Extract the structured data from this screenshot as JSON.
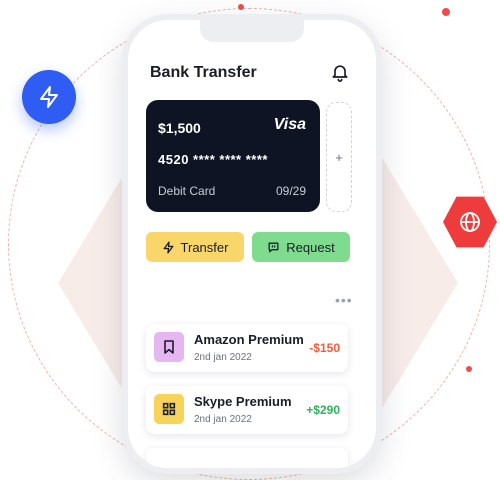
{
  "header": {
    "title": "Bank Transfer",
    "bell_icon": "bell-icon"
  },
  "card": {
    "balance": "$1,500",
    "brand": "Visa",
    "number": "4520 **** ****  ****",
    "type_label": "Debit Card",
    "expiry": "09/29",
    "add_label": "+"
  },
  "actions": {
    "transfer_label": "Transfer",
    "request_label": "Request"
  },
  "more_label": "•••",
  "transactions": [
    {
      "name": "Amazon Premium",
      "date": "2nd jan 2022",
      "amount": "-$150",
      "icon": "bookmark-icon"
    },
    {
      "name": "Skype Premium",
      "date": "2nd jan 2022",
      "amount": "+$290",
      "icon": "grid-icon"
    }
  ],
  "colors": {
    "accent_blue": "#2f5cf2",
    "accent_red": "#ee3b3b",
    "card_bg": "#0e1424",
    "transfer_btn": "#f9d66a",
    "request_btn": "#7fdc8f"
  }
}
